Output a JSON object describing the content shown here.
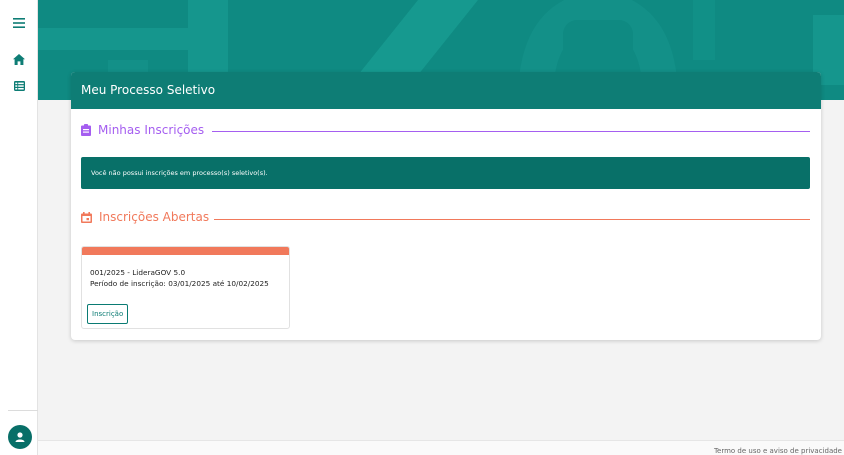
{
  "colors": {
    "teal": "#0e7d75",
    "purple": "#a55ef0",
    "orange": "#f1795b"
  },
  "sidebar": {
    "items": [
      {
        "icon": "menu-icon"
      },
      {
        "icon": "home-icon"
      },
      {
        "icon": "list-icon"
      }
    ],
    "avatar_icon": "user-icon"
  },
  "card": {
    "title": "Meu Processo Seletivo"
  },
  "my_inscriptions": {
    "title": "Minhas Inscrições",
    "icon": "clipboard-icon",
    "message": "Você não possui inscrições em processo(s) seletivo(s)."
  },
  "open_inscriptions": {
    "title": "Inscrições Abertas",
    "icon": "calendar-icon",
    "items": [
      {
        "name": "001/2025 - LideraGOV 5.0",
        "period": "Período de inscrição: 03/01/2025 até 10/02/2025",
        "button": "Inscrição"
      }
    ]
  },
  "footer": {
    "link": "Termo de uso e aviso de privacidade"
  }
}
